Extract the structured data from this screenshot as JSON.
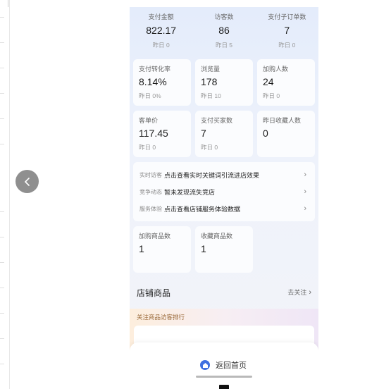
{
  "stats_top": [
    {
      "label": "支付金额",
      "value": "822.17",
      "sub": "昨日 0"
    },
    {
      "label": "访客数",
      "value": "86",
      "sub": "昨日 5"
    },
    {
      "label": "支付子订单数",
      "value": "7",
      "sub": "昨日 0"
    }
  ],
  "grid_row1": [
    {
      "label": "支付转化率",
      "value": "8.14%",
      "sub": "昨日 0%"
    },
    {
      "label": "浏览量",
      "value": "178",
      "sub": "昨日 10"
    },
    {
      "label": "加购人数",
      "value": "24",
      "sub": "昨日 0"
    }
  ],
  "grid_row2": [
    {
      "label": "客单价",
      "value": "117.45",
      "sub": "昨日 0"
    },
    {
      "label": "支付买家数",
      "value": "7",
      "sub": "昨日 0"
    },
    {
      "label": "昨日收藏人数",
      "value": "0",
      "sub": ""
    }
  ],
  "links": [
    {
      "key": "实时访客",
      "text": "点击查看实时关键词引流进店效果"
    },
    {
      "key": "竞争动态",
      "text": "暂未发现流失竞店"
    },
    {
      "key": "服务体验",
      "text": "点击查看店铺服务体验数据"
    }
  ],
  "grid_row3": [
    {
      "label": "加购商品数",
      "value": "1"
    },
    {
      "label": "收藏商品数",
      "value": "1"
    }
  ],
  "shop_goods": {
    "title": "店铺商品",
    "follow_label": "去关注"
  },
  "rank_title": "关注商品访客排行",
  "bottom": {
    "home_label": "返回首页"
  },
  "colors": {
    "accent": "#3f6fe0",
    "back_button": "#8f8f8f"
  }
}
